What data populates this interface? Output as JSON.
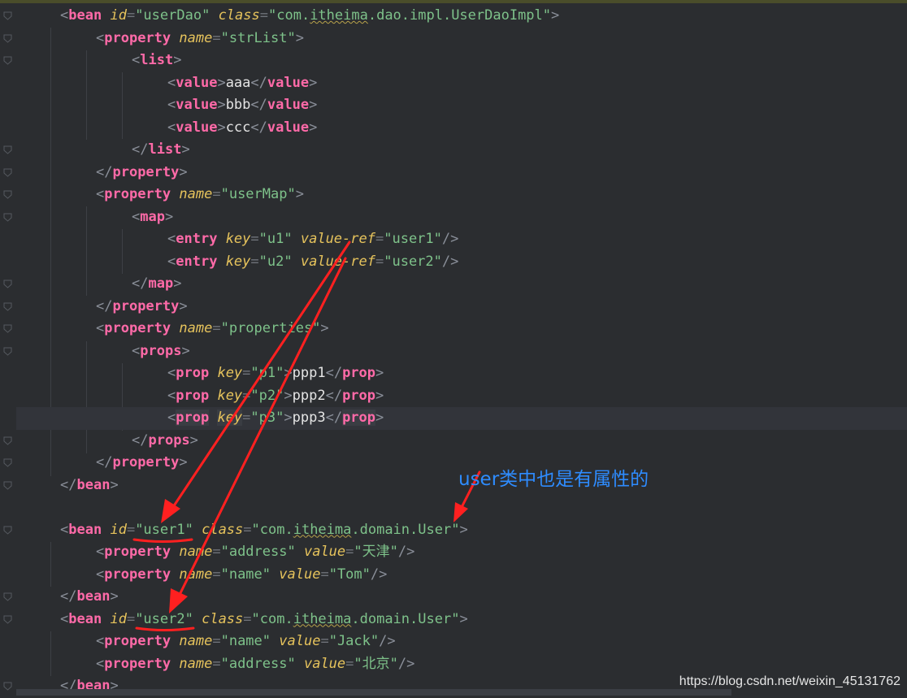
{
  "editor": {
    "lines": [
      "<bean id=\"userDao\" class=\"com.itheima.dao.impl.UserDaoImpl\">",
      "<property name=\"strList\">",
      "<list>",
      "<value>aaa</value>",
      "<value>bbb</value>",
      "<value>ccc</value>",
      "</list>",
      "</property>",
      "<property name=\"userMap\">",
      "<map>",
      "<entry key=\"u1\" value-ref=\"user1\"/>",
      "<entry key=\"u2\" value-ref=\"user2\"/>",
      "</map>",
      "</property>",
      "<property name=\"properties\">",
      "<props>",
      "<prop key=\"p1\">ppp1</prop>",
      "<prop key=\"p2\">ppp2</prop>",
      "<prop key=\"p3\">ppp3</prop>",
      "</props>",
      "</property>",
      "</bean>",
      "",
      "<bean id=\"user1\" class=\"com.itheima.domain.User\">",
      "<property name=\"address\" value=\"天津\"/>",
      "<property name=\"name\" value=\"Tom\"/>",
      "</bean>",
      "<bean id=\"user2\" class=\"com.itheima.domain.User\">",
      "<property name=\"name\" value=\"Jack\"/>",
      "<property name=\"address\" value=\"北京\"/>",
      "</bean>"
    ]
  },
  "annotation": "user类中也是有属性的",
  "watermark": "https://blog.csdn.net/weixin_45131762",
  "colors": {
    "background": "#2b2d30",
    "tag": "#ff6aa8",
    "attribute": "#e6c35c",
    "string": "#7ec28a",
    "annotation_arrow": "#ff2020",
    "annotation_text": "#2e8cff"
  }
}
